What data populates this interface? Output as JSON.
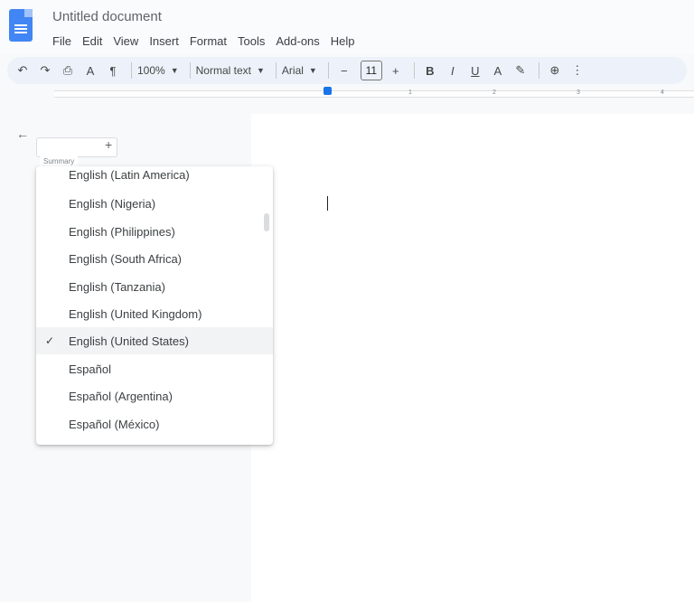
{
  "window": {
    "title": "Untitled document"
  },
  "menu": [
    "File",
    "Edit",
    "View",
    "Insert",
    "Format",
    "Tools",
    "Add-ons",
    "Help"
  ],
  "toolbar": {
    "undo": "↶",
    "redo": "↷",
    "print": "⎙",
    "spellcheck": "A",
    "paint": "¶",
    "zoom": "100%",
    "style": "Normal text",
    "font": "Arial",
    "font_size": "11",
    "minus": "−",
    "plus": "+",
    "bold": "B",
    "italic": "I",
    "underline": "U",
    "text_color": "A",
    "highlight": "✎",
    "link": "⊕",
    "more": "⋮"
  },
  "ruler": {
    "ticks": [
      "1",
      "2",
      "3",
      "4"
    ]
  },
  "outline": {
    "back": "←",
    "add": "+",
    "tooltip": "Summary"
  },
  "language_menu": {
    "items": [
      {
        "label": "English (Latin America)",
        "selected": false
      },
      {
        "label": "English (Nigeria)",
        "selected": false
      },
      {
        "label": "English (Philippines)",
        "selected": false
      },
      {
        "label": "English (South Africa)",
        "selected": false
      },
      {
        "label": "English (Tanzania)",
        "selected": false
      },
      {
        "label": "English (United Kingdom)",
        "selected": false
      },
      {
        "label": "English (United States)",
        "selected": true
      },
      {
        "label": "Español",
        "selected": false
      },
      {
        "label": "Español (Argentina)",
        "selected": false
      },
      {
        "label": "Español (México)",
        "selected": false
      }
    ],
    "check": "✓"
  },
  "colors": {
    "accent": "#1a73e8",
    "doc_icon": "#4285f4"
  }
}
